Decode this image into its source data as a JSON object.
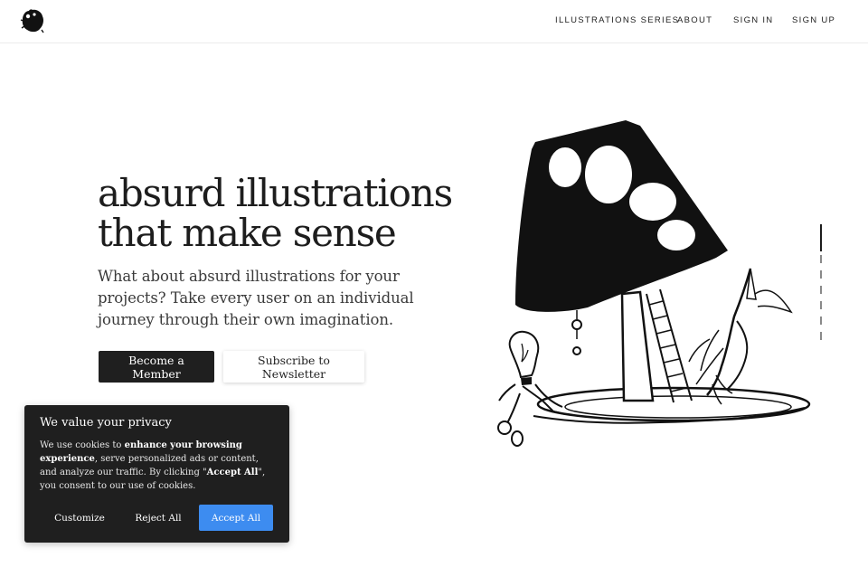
{
  "header": {
    "logo_icon": "ink-blot-logo-icon",
    "nav": [
      {
        "label": "ILLUSTRATIONS SERIES"
      },
      {
        "label": "ABOUT"
      },
      {
        "label": "SIGN IN"
      },
      {
        "label": "SIGN UP"
      }
    ]
  },
  "hero": {
    "title_line1": "absurd illustrations",
    "title_line2": "that make sense",
    "subtitle": "What about absurd illustrations for your projects? Take every user on an individual journey through their own imagination.",
    "primary_button": "Become a Member",
    "secondary_button": "Subscribe to Newsletter",
    "illustration_icon": "mushroom-lamp-illustration"
  },
  "cookie_banner": {
    "title": "We value your privacy",
    "text_1": "We use cookies to ",
    "text_bold_1": "enhance your browsing experience",
    "text_2": ", serve personalized ads or content, and analyze our traffic. By clicking \"",
    "text_bold_2": "Accept All",
    "text_3": "\", you consent to our use of cookies.",
    "customize": "Customize",
    "reject": "Reject All",
    "accept": "Accept All",
    "accept_color": "#3d8cf0"
  },
  "colors": {
    "background": "#ffffff",
    "text": "#1d1d1d",
    "dark_button": "#1f1f1f"
  }
}
